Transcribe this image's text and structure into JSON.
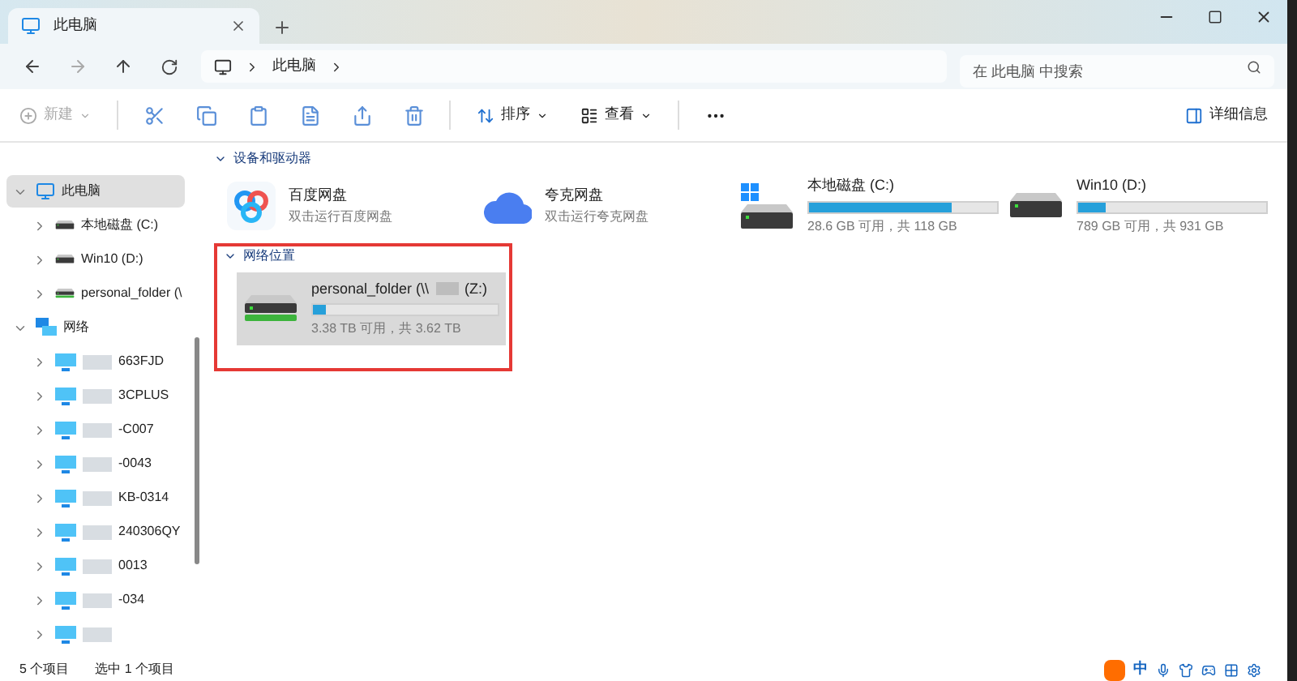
{
  "tabs": [
    {
      "label": "此电脑",
      "selected": true
    }
  ],
  "address": {
    "crumbs": [
      "此电脑"
    ]
  },
  "search": {
    "placeholder": "在 此电脑 中搜索"
  },
  "toolbar": {
    "new": {
      "label": "新建",
      "disabled": true
    },
    "sort": "排序",
    "view": "查看",
    "details": "详细信息"
  },
  "sidebar": {
    "items": [
      {
        "label": "此电脑",
        "kind": "pc",
        "expanded": true,
        "selected": true,
        "children": [
          {
            "label": "本地磁盘 (C:)",
            "kind": "disk"
          },
          {
            "label": "Win10 (D:)",
            "kind": "disk"
          },
          {
            "label": "personal_folder (\\",
            "kind": "netdisk"
          }
        ]
      },
      {
        "label": "网络",
        "kind": "network",
        "expanded": true,
        "selected": false,
        "children": [
          {
            "label": "663FJD",
            "kind": "computer"
          },
          {
            "label": "3CPLUS",
            "kind": "computer"
          },
          {
            "label": "-C007",
            "kind": "computer"
          },
          {
            "label": "-0043",
            "kind": "computer"
          },
          {
            "label": "KB-0314",
            "kind": "computer"
          },
          {
            "label": "240306QY",
            "kind": "computer"
          },
          {
            "label": "0013",
            "kind": "computer"
          },
          {
            "label": "-034",
            "kind": "computer"
          },
          {
            "kind": "computer"
          }
        ]
      }
    ]
  },
  "sections": [
    {
      "title": "设备和驱动器",
      "expanded": true,
      "highlighted": false,
      "items": [
        {
          "kind": "app",
          "name": "百度网盘",
          "subtitle": "双击运行百度网盘"
        },
        {
          "kind": "app",
          "name": "夸克网盘",
          "subtitle": "双击运行夸克网盘"
        },
        {
          "kind": "drive",
          "system": true,
          "name": "本地磁盘 (C:)",
          "level": 0.76,
          "subtitle": "28.6 GB 可用，共 118 GB"
        },
        {
          "kind": "drive",
          "system": false,
          "name": "Win10 (D:)",
          "level": 0.15,
          "subtitle": "789 GB 可用，共 931 GB"
        }
      ]
    },
    {
      "title": "网络位置",
      "expanded": true,
      "highlighted": true,
      "items": [
        {
          "kind": "netdrive",
          "selected": true,
          "name": "personal_folder (\\\\",
          "letter": "(Z:)",
          "level": 0.066,
          "subtitle": "3.38 TB 可用，共 3.62 TB"
        }
      ]
    }
  ],
  "status_bar": {
    "count": "5 个项目",
    "selection": "选中 1 个项目"
  },
  "ime": {
    "label": "中"
  }
}
